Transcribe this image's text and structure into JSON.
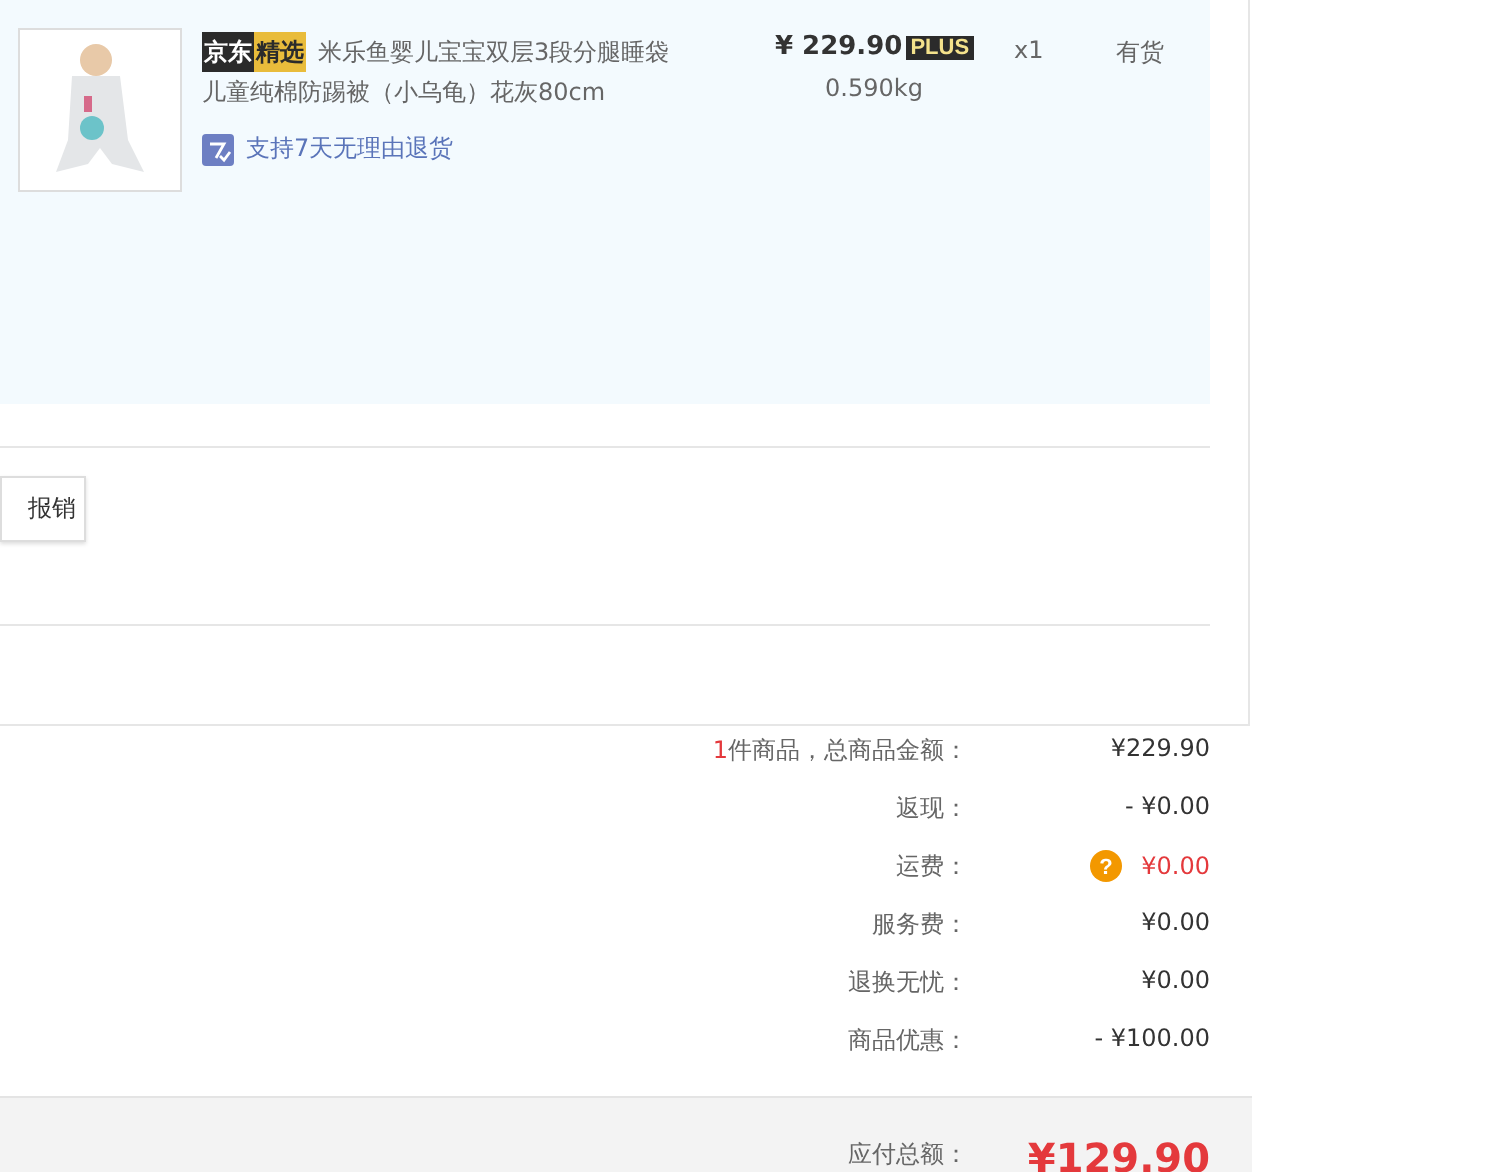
{
  "product": {
    "store_badge": "京东",
    "select_badge": "精选",
    "title_lines": [
      "米乐鱼婴儿宝宝双层3段分腿睡袋",
      "儿童纯棉防踢被（小乌龟）花灰80cm"
    ],
    "service": "支持7天无理由退货",
    "price": "¥ 229.90",
    "price_badge": "PLUS",
    "weight": "0.590kg",
    "quantity": "x1",
    "stock": "有货"
  },
  "action_button": "报销",
  "summary": [
    {
      "kind": "count",
      "count": "1",
      "label": "件商品，总商品金额：",
      "value": "¥229.90"
    },
    {
      "kind": "plain",
      "label": "返现：",
      "value": "- ¥0.00"
    },
    {
      "kind": "help",
      "help_glyph": "?",
      "label": "运费：",
      "value": "¥0.00"
    },
    {
      "kind": "plain",
      "label": "服务费：",
      "value": "¥0.00"
    },
    {
      "kind": "plain",
      "label": "退换无忧：",
      "value": "¥0.00"
    },
    {
      "kind": "plain",
      "label": "商品优惠：",
      "value": "- ¥100.00"
    }
  ],
  "total": {
    "label": "应付总额：",
    "value": "¥129.90"
  }
}
